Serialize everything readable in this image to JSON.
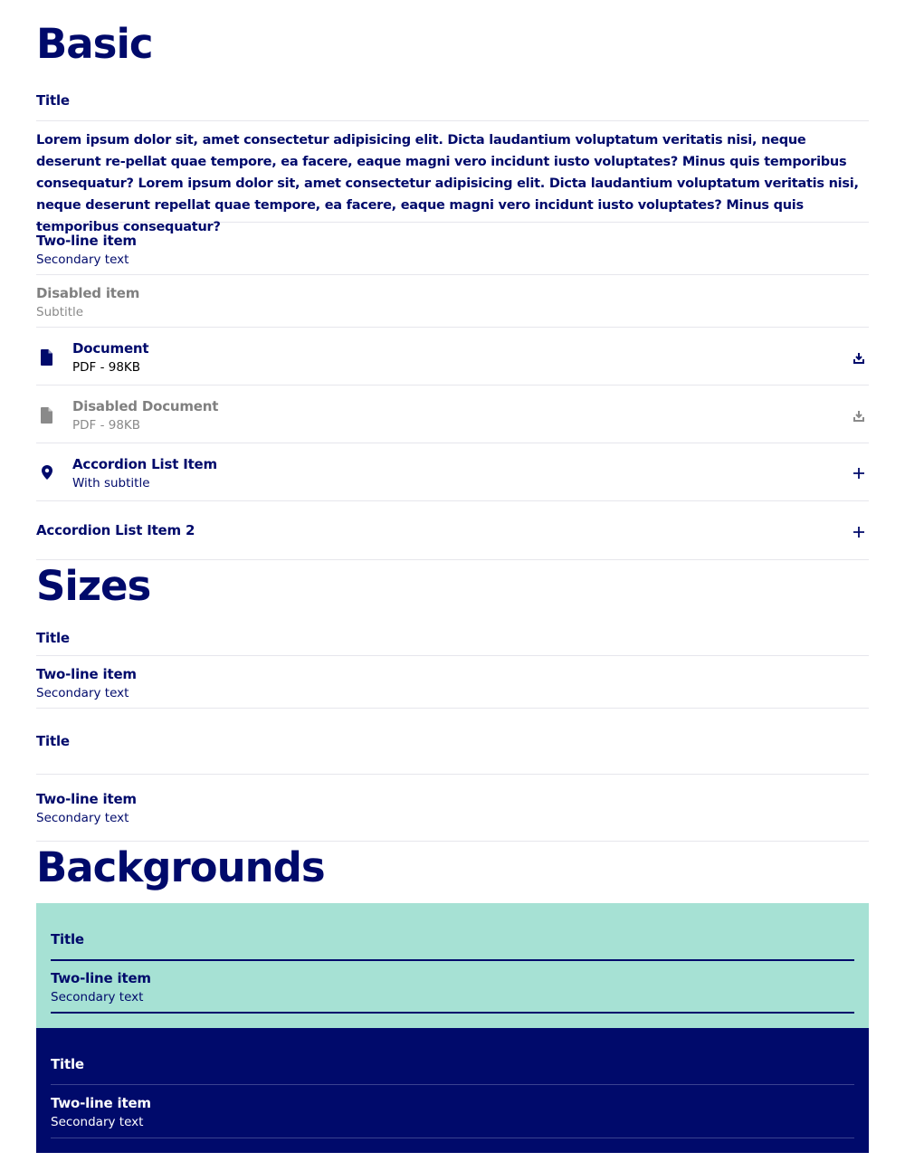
{
  "basic": {
    "heading": "Basic",
    "title_item": "Title",
    "paragraph": "Lorem ipsum dolor sit, amet consectetur adipisicing elit. Dicta laudantium voluptatum veritatis nisi, neque deserunt re-pellat quae tempore, ea facere, eaque magni vero incidunt iusto voluptates? Minus quis temporibus consequatur? Lorem ipsum dolor sit, amet consectetur adipisicing elit. Dicta laudantium voluptatum veritatis nisi, neque deserunt repellat quae tempore, ea facere, eaque magni vero incidunt iusto voluptates? Minus quis temporibus consequatur?",
    "two_line": {
      "title": "Two-line item",
      "subtitle": "Secondary text"
    },
    "disabled": {
      "title": "Disabled item",
      "subtitle": "Subtitle"
    },
    "document": {
      "title": "Document",
      "subtitle": "PDF - 98KB",
      "icon": "document-icon",
      "action_icon": "download-icon"
    },
    "disabled_document": {
      "title": "Disabled Document",
      "subtitle": "PDF - 98KB",
      "icon": "document-icon",
      "action_icon": "download-icon"
    },
    "accordion1": {
      "title": "Accordion List Item",
      "subtitle": "With subtitle",
      "icon": "location-pin-icon",
      "action_icon": "plus-icon"
    },
    "accordion2": {
      "title": "Accordion List Item 2",
      "action_icon": "plus-icon"
    }
  },
  "sizes": {
    "heading": "Sizes",
    "small_title": "Title",
    "small_two_line": {
      "title": "Two-line item",
      "subtitle": "Secondary text"
    },
    "large_title": "Title",
    "large_two_line": {
      "title": "Two-line item",
      "subtitle": "Secondary text"
    }
  },
  "backgrounds": {
    "heading": "Backgrounds",
    "mint": {
      "color": "#a6e1d4",
      "title": "Title",
      "two_line": {
        "title": "Two-line item",
        "subtitle": "Secondary text"
      }
    },
    "navy": {
      "color": "#000a6b",
      "title": "Title",
      "two_line": {
        "title": "Two-line item",
        "subtitle": "Secondary text"
      }
    }
  },
  "colors": {
    "primary": "#000a6b",
    "disabled": "#808080",
    "divider": "#e6e6ec"
  }
}
